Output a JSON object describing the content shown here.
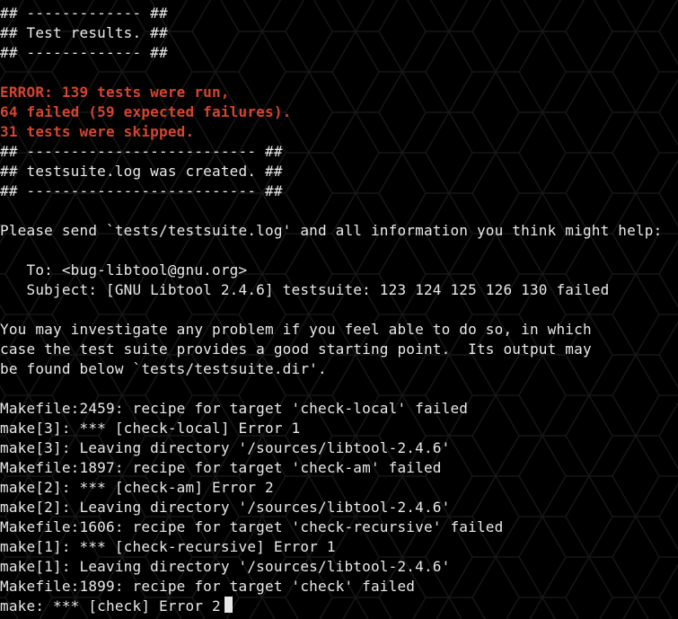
{
  "terminal": {
    "lines": [
      {
        "text": "## ------------- ##",
        "cls": "w"
      },
      {
        "text": "## Test results. ##",
        "cls": "w"
      },
      {
        "text": "## ------------- ##",
        "cls": "w"
      },
      {
        "text": "",
        "cls": "w"
      },
      {
        "text": "ERROR: 139 tests were run,",
        "cls": "err"
      },
      {
        "text": "64 failed (59 expected failures).",
        "cls": "err"
      },
      {
        "text": "31 tests were skipped.",
        "cls": "err"
      },
      {
        "text": "## -------------------------- ##",
        "cls": "w"
      },
      {
        "text": "## testsuite.log was created. ##",
        "cls": "w"
      },
      {
        "text": "## -------------------------- ##",
        "cls": "w"
      },
      {
        "text": "",
        "cls": "w"
      },
      {
        "text": "Please send `tests/testsuite.log' and all information you think might help:",
        "cls": "w"
      },
      {
        "text": "",
        "cls": "w"
      },
      {
        "text": "   To: <bug-libtool@gnu.org>",
        "cls": "w"
      },
      {
        "text": "   Subject: [GNU Libtool 2.4.6] testsuite: 123 124 125 126 130 failed",
        "cls": "w"
      },
      {
        "text": "",
        "cls": "w"
      },
      {
        "text": "You may investigate any problem if you feel able to do so, in which",
        "cls": "w"
      },
      {
        "text": "case the test suite provides a good starting point.  Its output may",
        "cls": "w"
      },
      {
        "text": "be found below `tests/testsuite.dir'.",
        "cls": "w"
      },
      {
        "text": "",
        "cls": "w"
      },
      {
        "text": "Makefile:2459: recipe for target 'check-local' failed",
        "cls": "w"
      },
      {
        "text": "make[3]: *** [check-local] Error 1",
        "cls": "w"
      },
      {
        "text": "make[3]: Leaving directory '/sources/libtool-2.4.6'",
        "cls": "w"
      },
      {
        "text": "Makefile:1897: recipe for target 'check-am' failed",
        "cls": "w"
      },
      {
        "text": "make[2]: *** [check-am] Error 2",
        "cls": "w"
      },
      {
        "text": "make[2]: Leaving directory '/sources/libtool-2.4.6'",
        "cls": "w"
      },
      {
        "text": "Makefile:1606: recipe for target 'check-recursive' failed",
        "cls": "w"
      },
      {
        "text": "make[1]: *** [check-recursive] Error 1",
        "cls": "w"
      },
      {
        "text": "make[1]: Leaving directory '/sources/libtool-2.4.6'",
        "cls": "w"
      },
      {
        "text": "Makefile:1899: recipe for target 'check' failed",
        "cls": "w"
      },
      {
        "text": "make: *** [check] Error 2",
        "cls": "w"
      }
    ]
  }
}
